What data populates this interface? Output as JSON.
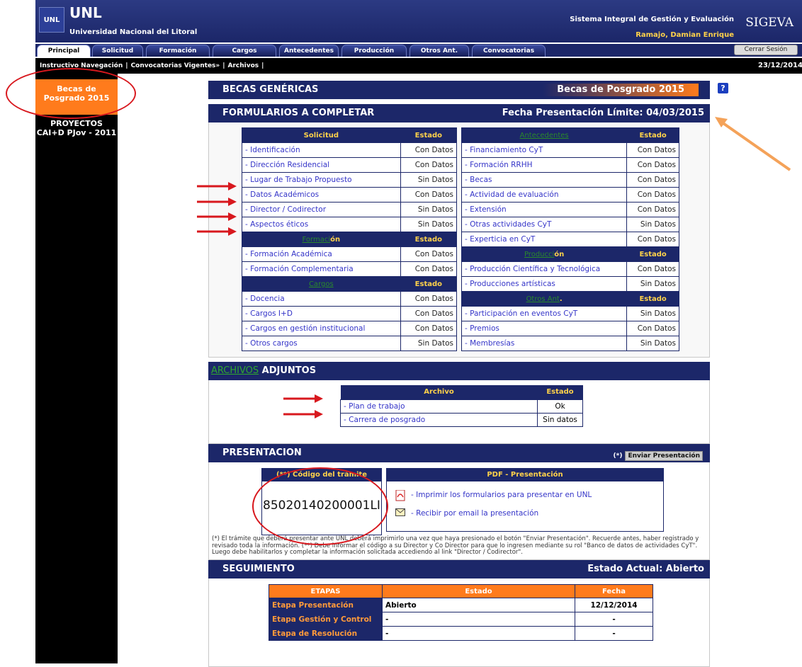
{
  "header": {
    "logo_text": "UNL",
    "brand": "UNL",
    "brand_sub": "Universidad Nacional del Litoral",
    "system_title": "Sistema Integral de Gestión y Evaluación",
    "user_name": "Ramajo, Damian Enrique",
    "sigeva": "SIGEVA"
  },
  "tabs": [
    "Principal",
    "Solicitud",
    "Formación",
    "Cargos",
    "Antecedentes",
    "Producción",
    "Otros Ant.",
    "Convocatorias"
  ],
  "logout": "Cerrar Sesión",
  "subnav": {
    "items": [
      "Instructivo Navegación",
      "|",
      "Convocatorias Vigentes»",
      "|",
      "Archivos",
      "|"
    ],
    "date": "23/12/2014"
  },
  "sidebar": {
    "item1": "Becas de Posgrado 2015",
    "item2": "PROYECTOS CAI+D PJov - 2011"
  },
  "becas": {
    "left": "BECAS GENÉRICAS",
    "right": "Becas de Posgrado 2015"
  },
  "forms": {
    "title": "FORMULARIOS A COMPLETAR",
    "deadline_label": "Fecha Presentación Límite:",
    "deadline": "04/03/2015",
    "estado": "Estado",
    "left": [
      {
        "section": "Solicitud",
        "rows": [
          [
            "- Identificación",
            "Con Datos"
          ],
          [
            "- Dirección Residencial",
            "Con Datos"
          ],
          [
            "- Lugar de Trabajo Propuesto",
            "Sin Datos"
          ],
          [
            "- Datos Académicos",
            "Con Datos"
          ],
          [
            "- Director / Codirector",
            "Sin Datos"
          ],
          [
            "- Aspectos éticos",
            "Sin Datos"
          ]
        ]
      },
      {
        "section_link": "Formaci",
        "section_rest": "ón",
        "rows": [
          [
            "- Formación Académica",
            "Con Datos"
          ],
          [
            "- Formación Complementaria",
            "Con Datos"
          ]
        ]
      },
      {
        "section_link": "Cargos",
        "section_rest": "",
        "rows": [
          [
            "- Docencia",
            "Con Datos"
          ],
          [
            "- Cargos I+D",
            "Con Datos"
          ],
          [
            "- Cargos en gestión institucional",
            "Con Datos"
          ],
          [
            "- Otros cargos",
            "Sin Datos"
          ]
        ]
      }
    ],
    "right": [
      {
        "section_link": "Antecedentes",
        "section_rest": "",
        "rows": [
          [
            "- Financiamiento CyT",
            "Con Datos"
          ],
          [
            "- Formación RRHH",
            "Con Datos"
          ],
          [
            "- Becas",
            "Con Datos"
          ],
          [
            "- Actividad de evaluación",
            "Con Datos"
          ],
          [
            "- Extensión",
            "Con Datos"
          ],
          [
            "- Otras actividades CyT",
            "Sin Datos"
          ],
          [
            "- Experticia en CyT",
            "Con Datos"
          ]
        ]
      },
      {
        "section_link": "Producci",
        "section_rest": "ón",
        "rows": [
          [
            "- Producción Científica y Tecnológica",
            "Con Datos"
          ],
          [
            "- Producciones artísticas",
            "Sin Datos"
          ]
        ]
      },
      {
        "section_link": "Otros Ant",
        "section_rest": ".",
        "rows": [
          [
            "- Participación en eventos CyT",
            "Sin Datos"
          ],
          [
            "- Premios",
            "Con Datos"
          ],
          [
            "- Membresías",
            "Sin Datos"
          ]
        ]
      }
    ]
  },
  "files": {
    "link": "ARCHIVOS",
    "title": "ADJUNTOS",
    "col1": "Archivo",
    "col2": "Estado",
    "rows": [
      [
        "- Plan de trabajo",
        "Ok"
      ],
      [
        "- Carrera de posgrado",
        "Sin datos"
      ]
    ]
  },
  "presentation": {
    "title": "PRESENTACION",
    "send_prefix": "(*)",
    "send_label": "Enviar Presentación",
    "code_head": "(**) Código del trámite",
    "code": "85020140200001LI",
    "pdf_head": "PDF - Presentación",
    "pdf_print": "- Imprimir los formularios para presentar en UNL",
    "pdf_mail": "- Recibir por email la presentación",
    "note": "(*) El trámite que deberá presentar ante UNL deberá imprimirlo una vez que haya presionado el botón \"Enviar Presentación\". Recuerde antes, haber registrado y revisado toda la información. (**) Debe informar el código a su Director y Co Director para que lo ingresen mediante su rol \"Banco de datos de actividades CyT\". Luego debe habilitarlos y completar la información solicitada accediendo al link \"Director / Codirector\"."
  },
  "tracking": {
    "title": "SEGUIMIENTO",
    "state_label": "Estado Actual:",
    "state": "Abierto",
    "col1": "ETAPAS",
    "col2": "Estado",
    "col3": "Fecha",
    "rows": [
      [
        "Etapa Presentación",
        "Abierto",
        "12/12/2014"
      ],
      [
        "Etapa Gestión y Control",
        "-",
        "-"
      ],
      [
        "Etapa de Resolución",
        "-",
        "-"
      ]
    ]
  },
  "colors": {
    "navy": "#1c2769",
    "orange": "#ff7b1c",
    "annotation_red": "#d8181e",
    "annotation_orange": "#f4a259"
  }
}
